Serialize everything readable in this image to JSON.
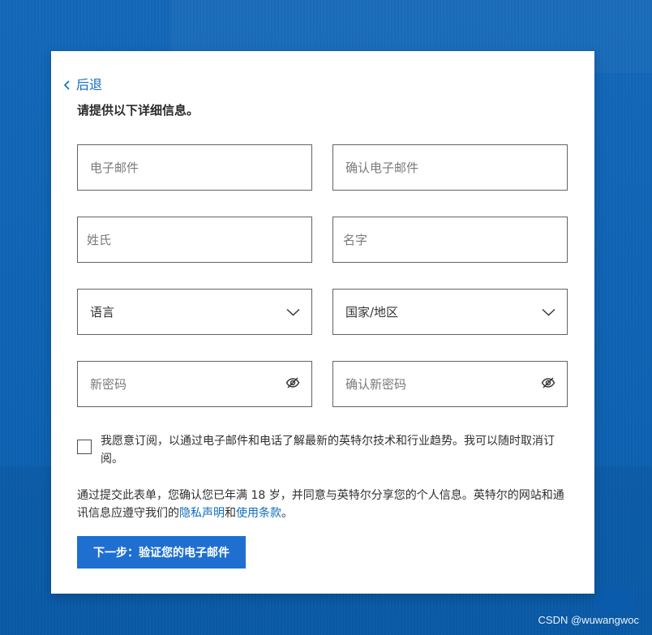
{
  "page": {
    "back_label": "后退",
    "title": "请提供以下详细信息。",
    "watermark": "CSDN @wuwangwoc"
  },
  "form": {
    "email_placeholder": "电子邮件",
    "confirm_email_placeholder": "确认电子邮件",
    "last_name_placeholder": "姓氏",
    "first_name_placeholder": "名字",
    "language_label": "语言",
    "country_label": "国家/地区",
    "new_password_placeholder": "新密码",
    "confirm_new_password_placeholder": "确认新密码"
  },
  "subscription": {
    "checkbox_text": "我愿意订阅，以通过电子邮件和电话了解最新的英特尔技术和行业趋势。我可以随时取消订阅。"
  },
  "consent": {
    "prefix": "通过提交此表单，您确认您已年满 18 岁，并同意与英特尔分享您的个人信息。英特尔的网站和通讯信息应遵守我们的",
    "privacy_link": "隐私声明",
    "middle": "和",
    "terms_link": "使用条款",
    "suffix": "。"
  },
  "actions": {
    "next_label": "下一步：验证您的电子邮件"
  },
  "icons": {
    "back": "chevron-left-icon",
    "dropdown": "chevron-down-icon",
    "password_visibility": "eye-off-icon"
  },
  "colors": {
    "background": "#0b63b6",
    "card": "#ffffff",
    "link": "#0f6cbd",
    "button": "#1f6fd1"
  }
}
